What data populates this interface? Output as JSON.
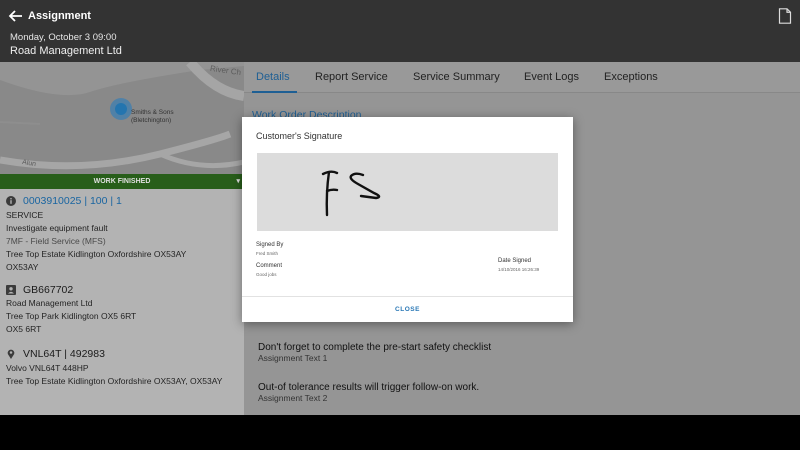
{
  "header": {
    "title": "Assignment",
    "date": "Monday, October 3 09:00",
    "company": "Road Management Ltd"
  },
  "map": {
    "river_label": "River Ch",
    "road_label": "Alun",
    "marker_label": "Smiths & Sons (Bletchington)"
  },
  "status": {
    "label": "WORK FINISHED",
    "color": "#2e6b1e"
  },
  "work_order": {
    "number": "0003910025 | 100 | 1",
    "lines": [
      "SERVICE",
      "Investigate equipment fault",
      "7MF - Field Service (MFS)",
      "Tree Top Estate Kidlington Oxfordshire OX53AY",
      "OX53AY"
    ]
  },
  "customer": {
    "id": "GB667702",
    "lines": [
      "Road Management Ltd",
      "Tree Top Park Kidlington OX5 6RT",
      "OX5 6RT"
    ]
  },
  "asset": {
    "id": "VNL64T | 492983",
    "lines": [
      "Volvo VNL64T 448HP",
      "Tree Top Estate Kidlington Oxfordshire OX53AY, OX53AY"
    ]
  },
  "tabs": [
    "Details",
    "Report Service",
    "Service Summary",
    "Event Logs",
    "Exceptions"
  ],
  "details": {
    "section_title": "Work Order Description",
    "assignments": [
      {
        "text": "Don't forget to complete the pre-start safety checklist",
        "sub": "Assignment Text 1"
      },
      {
        "text": "Out-of tolerance results will trigger follow-on work.",
        "sub": "Assignment Text 2"
      }
    ]
  },
  "modal": {
    "title": "Customer's Signature",
    "signed_by_label": "Signed By",
    "signed_by_value": "Fred Smith",
    "comment_label": "Comment",
    "comment_value": "Good jobs",
    "date_label": "Date Signed",
    "date_value": "14/10/2016 16:26:39",
    "close_label": "CLOSE"
  },
  "colors": {
    "accent": "#1e74b8",
    "header_bg": "#333333"
  }
}
